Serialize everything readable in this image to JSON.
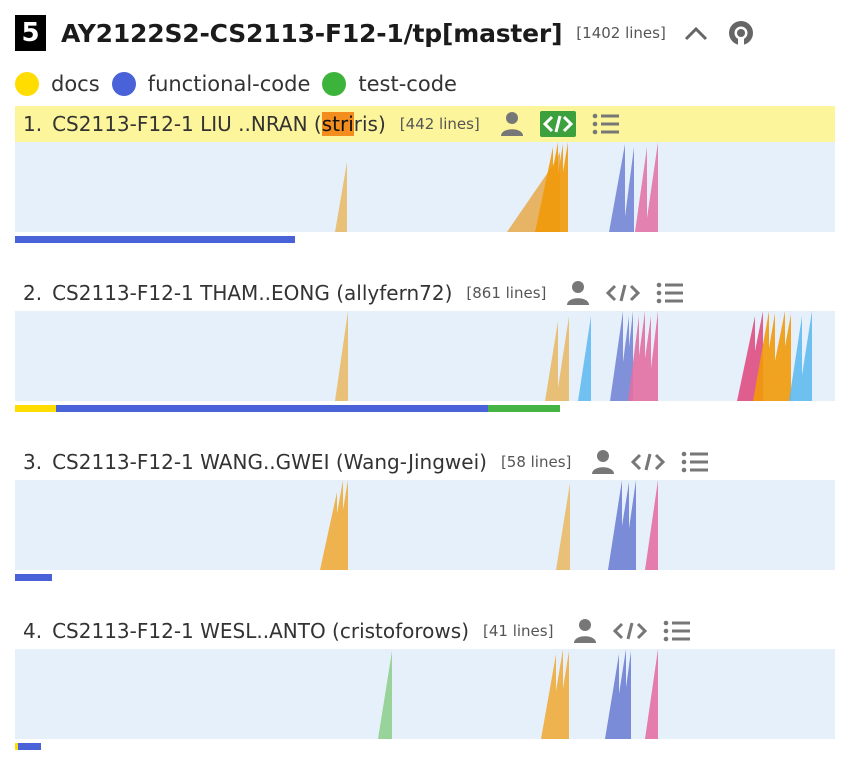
{
  "repo": {
    "index": "5",
    "name": "AY2122S2-CS2113-F12-1/tp[master]",
    "lines": "[1402 lines]"
  },
  "legend": [
    {
      "label": "docs",
      "color": "#ffdd00"
    },
    {
      "label": "functional-code",
      "color": "#4a62d8"
    },
    {
      "label": "test-code",
      "color": "#3cb43c"
    }
  ],
  "authors": [
    {
      "rank": "1.",
      "name_before": "CS2113-F12-1 LIU ..NRAN (",
      "name_match": "stri",
      "name_after": "ris)",
      "lines": "[442 lines]",
      "highlighted": true,
      "breakdown_fraction_of_ramp": {
        "docs": 0.0,
        "functional-code": 0.341,
        "test-code": 0.0
      }
    },
    {
      "rank": "2.",
      "name_before": "CS2113-F12-1 THAM..EONG (allyfern72)",
      "name_match": "",
      "name_after": "",
      "lines": "[861 lines]",
      "highlighted": false,
      "breakdown_fraction_of_ramp": {
        "docs": 0.05,
        "functional-code": 0.527,
        "test-code": 0.088
      }
    },
    {
      "rank": "3.",
      "name_before": "CS2113-F12-1 WANG..GWEI (Wang-Jingwei)",
      "name_match": "",
      "name_after": "",
      "lines": "[58 lines]",
      "highlighted": false,
      "breakdown_fraction_of_ramp": {
        "docs": 0.0,
        "functional-code": 0.045,
        "test-code": 0.0
      }
    },
    {
      "rank": "4.",
      "name_before": "CS2113-F12-1 WESL..ANTO (cristoforows)",
      "name_match": "",
      "name_after": "",
      "lines": "[41 lines]",
      "highlighted": false,
      "breakdown_fraction_of_ramp": {
        "docs": 0.004,
        "functional-code": 0.028,
        "test-code": 0.0
      }
    }
  ],
  "icons": [
    "chevron-up-icon",
    "github-icon",
    "person-icon",
    "code-icon",
    "list-icon"
  ],
  "colors": {
    "ramp_background": "#e6f0fb",
    "highlight": "#fdf59b",
    "search_match": "#f28d1e",
    "active_code_icon": "#3ca03c"
  }
}
